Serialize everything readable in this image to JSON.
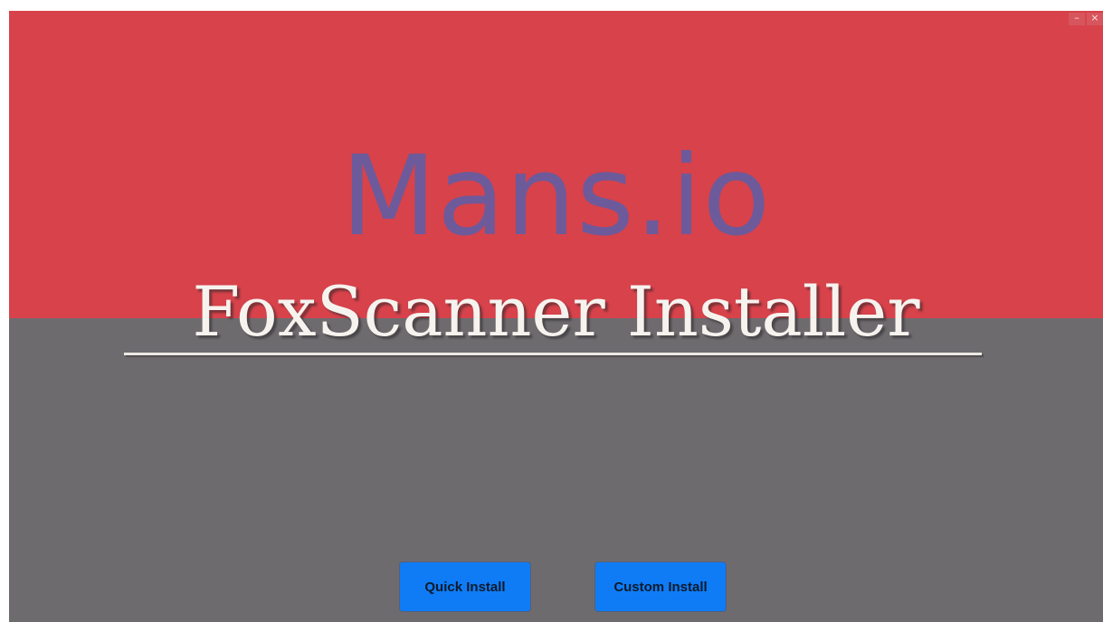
{
  "window": {
    "minimize_label": "–",
    "close_label": "×"
  },
  "brand": {
    "watermark": "Mans.io"
  },
  "installer": {
    "title": "FoxScanner Installer"
  },
  "buttons": {
    "quick_install": "Quick Install",
    "custom_install": "Custom Install"
  },
  "colors": {
    "top_band": "#d7424b",
    "bottom_band": "#6e6b6f",
    "watermark": "#6d5a9b",
    "title": "#f6f3ef",
    "button": "#0f7cf5"
  }
}
